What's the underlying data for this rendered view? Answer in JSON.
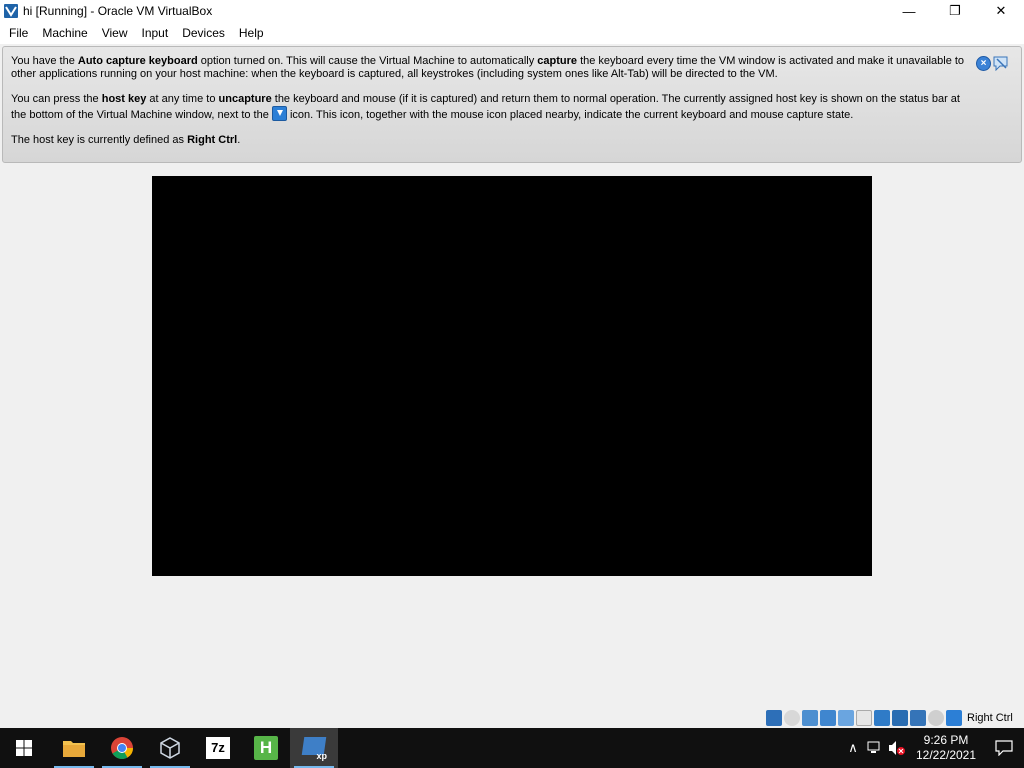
{
  "window": {
    "title": "hi [Running] - Oracle VM VirtualBox",
    "app_icon": "virtualbox-icon",
    "controls": {
      "minimize": "—",
      "restore": "❐",
      "close": "✕"
    }
  },
  "menu": [
    "File",
    "Machine",
    "View",
    "Input",
    "Devices",
    "Help"
  ],
  "notice": {
    "p1_a": "You have the ",
    "p1_b": "Auto capture keyboard",
    "p1_c": " option turned on. This will cause the Virtual Machine to automatically ",
    "p1_d": "capture",
    "p1_e": " the keyboard every time the VM window is activated and make it unavailable to other applications running on your host machine: when the keyboard is captured, all keystrokes (including system ones like Alt-Tab) will be directed to the VM.",
    "p2_a": "You can press the ",
    "p2_b": "host key",
    "p2_c": " at any time to ",
    "p2_d": "uncapture",
    "p2_e": " the keyboard and mouse (if it is captured) and return them to normal operation. The currently assigned host key is shown on the status bar at the bottom of the Virtual Machine window, next to the ",
    "p2_f": " icon. This icon, together with the mouse icon placed nearby, indicate the current keyboard and mouse capture state.",
    "p3_a": "The host key is currently defined as ",
    "p3_b": "Right Ctrl",
    "p3_c": ".",
    "close_symbol": "×"
  },
  "statusbar": {
    "icons": [
      "hard-disk-icon",
      "optical-drive-icon",
      "audio-icon",
      "network-icon",
      "usb-icon",
      "shared-folder-icon",
      "display-icon",
      "recording-icon",
      "virtualization-icon",
      "mouse-integration-icon",
      "host-key-icon"
    ],
    "host_key_label": "Right Ctrl"
  },
  "taskbar": {
    "apps": [
      "file-explorer-icon",
      "chrome-icon",
      "virtualbox-icon",
      "7zip-icon",
      "hxd-icon",
      "vm-xp-icon"
    ],
    "app_labels": {
      "7zip": "7z",
      "hxd": "H",
      "xp": "xp"
    },
    "tray": {
      "chevron": "∧"
    },
    "time": "9:26 PM",
    "date": "12/22/2021"
  },
  "colors": {
    "taskbar": "#101010",
    "accent": "#76b9ed",
    "vm_screen": "#000000"
  }
}
